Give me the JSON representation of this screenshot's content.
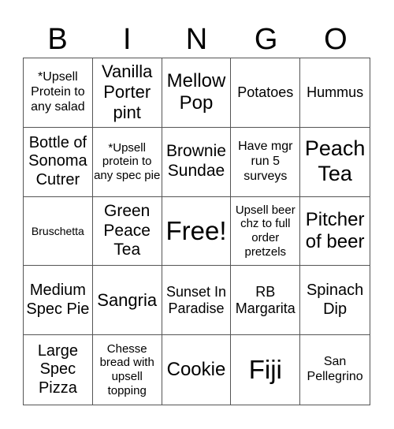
{
  "header": [
    "B",
    "I",
    "N",
    "G",
    "O"
  ],
  "cells": [
    "*Upsell Protein to any salad",
    "Vanilla Porter pint",
    "Mellow Pop",
    "Potatoes",
    "Hummus",
    "Bottle of Sonoma Cutrer",
    "*Upsell protein to any spec pie",
    "Brownie Sundae",
    "Have mgr run 5 surveys",
    "Peach Tea",
    "Bruschetta",
    "Green Peace Tea",
    "Free!",
    "Upsell beer chz to full order pretzels",
    "Pitcher of beer",
    "Medium Spec Pie",
    "Sangria",
    "Sunset In Paradise",
    "RB Margarita",
    "Spinach Dip",
    "Large Spec Pizza",
    "Chesse bread with upsell topping",
    "Cookie",
    "Fiji",
    "San Pellegrino"
  ]
}
